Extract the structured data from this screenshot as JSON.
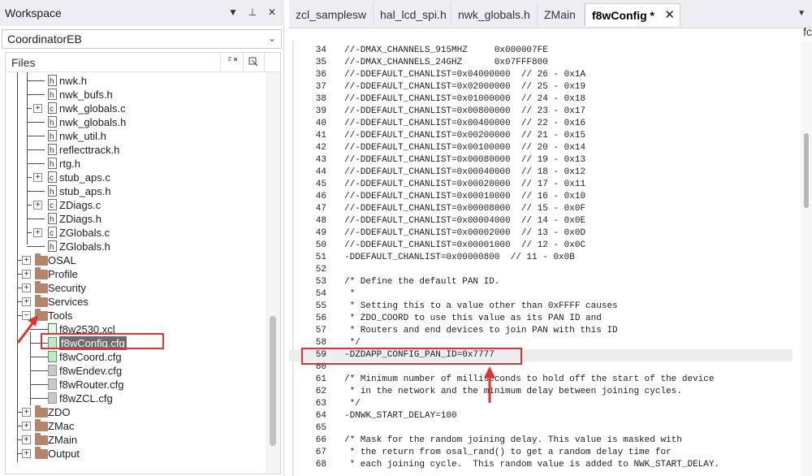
{
  "workspace": {
    "title": "Workspace",
    "controls": {
      "dropdown": "▼",
      "pin": "⊥",
      "close": "✕"
    },
    "configuration": "CoordinatorEB",
    "files_header": "Files",
    "header_icons": [
      "sort-icon",
      "options-icon"
    ],
    "tree": [
      {
        "label": "nwk.h",
        "kind": "file",
        "icon": "file-h-icon",
        "expander": ""
      },
      {
        "label": "nwk_bufs.h",
        "kind": "file",
        "icon": "file-h-icon",
        "expander": ""
      },
      {
        "label": "nwk_globals.c",
        "kind": "file",
        "icon": "file-c-icon",
        "expander": "+"
      },
      {
        "label": "nwk_globals.h",
        "kind": "file",
        "icon": "file-h-icon",
        "expander": ""
      },
      {
        "label": "nwk_util.h",
        "kind": "file",
        "icon": "file-h-icon",
        "expander": ""
      },
      {
        "label": "reflecttrack.h",
        "kind": "file",
        "icon": "file-h-icon",
        "expander": ""
      },
      {
        "label": "rtg.h",
        "kind": "file",
        "icon": "file-h-icon",
        "expander": ""
      },
      {
        "label": "stub_aps.c",
        "kind": "file",
        "icon": "file-c-icon",
        "expander": "+"
      },
      {
        "label": "stub_aps.h",
        "kind": "file",
        "icon": "file-h-icon",
        "expander": ""
      },
      {
        "label": "ZDiags.c",
        "kind": "file",
        "icon": "file-c-icon",
        "expander": "+"
      },
      {
        "label": "ZDiags.h",
        "kind": "file",
        "icon": "file-h-icon",
        "expander": ""
      },
      {
        "label": "ZGlobals.c",
        "kind": "file",
        "icon": "file-c-icon",
        "expander": "+"
      },
      {
        "label": "ZGlobals.h",
        "kind": "file",
        "icon": "file-h-icon",
        "expander": ""
      },
      {
        "label": "OSAL",
        "kind": "folder",
        "icon": "folder-icon",
        "expander": "+"
      },
      {
        "label": "Profile",
        "kind": "folder",
        "icon": "folder-icon",
        "expander": "+"
      },
      {
        "label": "Security",
        "kind": "folder",
        "icon": "folder-icon",
        "expander": "+"
      },
      {
        "label": "Services",
        "kind": "folder",
        "icon": "folder-icon",
        "expander": "+"
      },
      {
        "label": "Tools",
        "kind": "folder",
        "icon": "folder-icon",
        "expander": "−"
      },
      {
        "label": "f8w2530.xcl",
        "kind": "file",
        "icon": "file-xcl-icon",
        "expander": ""
      },
      {
        "label": "f8wConfig.cfg",
        "kind": "file",
        "icon": "file-cfg-icon",
        "expander": "",
        "selected": true
      },
      {
        "label": "f8wCoord.cfg",
        "kind": "file",
        "icon": "file-cfg-icon",
        "expander": ""
      },
      {
        "label": "f8wEndev.cfg",
        "kind": "file",
        "icon": "file-grey-icon",
        "expander": ""
      },
      {
        "label": "f8wRouter.cfg",
        "kind": "file",
        "icon": "file-grey-icon",
        "expander": ""
      },
      {
        "label": "f8wZCL.cfg",
        "kind": "file",
        "icon": "file-grey-icon",
        "expander": ""
      },
      {
        "label": "ZDO",
        "kind": "folder",
        "icon": "folder-icon",
        "expander": "+"
      },
      {
        "label": "ZMac",
        "kind": "folder",
        "icon": "folder-icon",
        "expander": "+"
      },
      {
        "label": "ZMain",
        "kind": "folder",
        "icon": "folder-icon",
        "expander": "+"
      },
      {
        "label": "Output",
        "kind": "folder",
        "icon": "folder-icon",
        "expander": "+"
      }
    ]
  },
  "editor": {
    "tabs": [
      {
        "label": "zcl_samplesw",
        "active": false
      },
      {
        "label": "hal_lcd_spi.h",
        "active": false
      },
      {
        "label": "nwk_globals.h",
        "active": false
      },
      {
        "label": "ZMain",
        "active": false
      },
      {
        "label": "f8wConfig *",
        "active": true,
        "close": "✕"
      }
    ],
    "tab_overflow": "▼",
    "right_glyph": "fc",
    "current_line": 59,
    "lines": [
      {
        "n": "34",
        "t": "//-DMAX_CHANNELS_915MHZ     0x000007FE"
      },
      {
        "n": "35",
        "t": "//-DMAX_CHANNELS_24GHZ      0x07FFF800"
      },
      {
        "n": "36",
        "t": "//-DDEFAULT_CHANLIST=0x04000000  // 26 - 0x1A"
      },
      {
        "n": "37",
        "t": "//-DDEFAULT_CHANLIST=0x02000000  // 25 - 0x19"
      },
      {
        "n": "38",
        "t": "//-DDEFAULT_CHANLIST=0x01000000  // 24 - 0x18"
      },
      {
        "n": "39",
        "t": "//-DDEFAULT_CHANLIST=0x00800000  // 23 - 0x17"
      },
      {
        "n": "40",
        "t": "//-DDEFAULT_CHANLIST=0x00400000  // 22 - 0x16"
      },
      {
        "n": "41",
        "t": "//-DDEFAULT_CHANLIST=0x00200000  // 21 - 0x15"
      },
      {
        "n": "42",
        "t": "//-DDEFAULT_CHANLIST=0x00100000  // 20 - 0x14"
      },
      {
        "n": "43",
        "t": "//-DDEFAULT_CHANLIST=0x00080000  // 19 - 0x13"
      },
      {
        "n": "44",
        "t": "//-DDEFAULT_CHANLIST=0x00040000  // 18 - 0x12"
      },
      {
        "n": "45",
        "t": "//-DDEFAULT_CHANLIST=0x00020000  // 17 - 0x11"
      },
      {
        "n": "46",
        "t": "//-DDEFAULT_CHANLIST=0x00010000  // 16 - 0x10"
      },
      {
        "n": "47",
        "t": "//-DDEFAULT_CHANLIST=0x00008000  // 15 - 0x0F"
      },
      {
        "n": "48",
        "t": "//-DDEFAULT_CHANLIST=0x00004000  // 14 - 0x0E"
      },
      {
        "n": "49",
        "t": "//-DDEFAULT_CHANLIST=0x00002000  // 13 - 0x0D"
      },
      {
        "n": "50",
        "t": "//-DDEFAULT_CHANLIST=0x00001000  // 12 - 0x0C"
      },
      {
        "n": "51",
        "t": "-DDEFAULT_CHANLIST=0x00000800  // 11 - 0x0B"
      },
      {
        "n": "52",
        "t": ""
      },
      {
        "n": "53",
        "t": "/* Define the default PAN ID."
      },
      {
        "n": "54",
        "t": " *"
      },
      {
        "n": "55",
        "t": " * Setting this to a value other than 0xFFFF causes"
      },
      {
        "n": "56",
        "t": " * ZDO_COORD to use this value as its PAN ID and"
      },
      {
        "n": "57",
        "t": " * Routers and end devices to join PAN with this ID"
      },
      {
        "n": "58",
        "t": " */"
      },
      {
        "n": "59",
        "t": "-DZDAPP_CONFIG_PAN_ID=0x7777"
      },
      {
        "n": "60",
        "t": ""
      },
      {
        "n": "61",
        "t": "/* Minimum number of milliseconds to hold off the start of the device"
      },
      {
        "n": "62",
        "t": " * in the network and the minimum delay between joining cycles."
      },
      {
        "n": "63",
        "t": " */"
      },
      {
        "n": "64",
        "t": "-DNWK_START_DELAY=100"
      },
      {
        "n": "65",
        "t": ""
      },
      {
        "n": "66",
        "t": "/* Mask for the random joining delay. This value is masked with"
      },
      {
        "n": "67",
        "t": " * the return from osal_rand() to get a random delay time for"
      },
      {
        "n": "68",
        "t": " * each joining cycle.  This random value is added to NWK_START_DELAY."
      }
    ]
  },
  "annotations": {
    "highlight_color": "#e03232"
  }
}
